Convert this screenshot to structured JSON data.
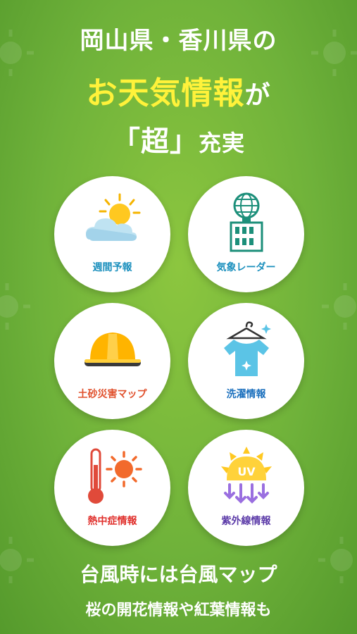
{
  "header": {
    "line1": "岡山県・香川県の",
    "line2_main": "お天気情報",
    "line2_suffix": "が",
    "line3_main": "「超」",
    "line3_suffix": "充実"
  },
  "features": [
    {
      "label": "週間予報",
      "icon": "sun-cloud-icon"
    },
    {
      "label": "気象レーダー",
      "icon": "radar-tower-icon"
    },
    {
      "label": "土砂災害マップ",
      "icon": "hard-hat-icon"
    },
    {
      "label": "洗濯情報",
      "icon": "shirt-hanger-icon"
    },
    {
      "label": "熱中症情報",
      "icon": "thermometer-sun-icon"
    },
    {
      "label": "紫外線情報",
      "icon": "uv-sun-icon"
    }
  ],
  "footer": {
    "line1": "台風時には台風マップ",
    "line2": "桜の開花情報や紅葉情報も"
  },
  "colors": {
    "background": "#6fb23a",
    "highlight": "#fff23a",
    "card": "#ffffff"
  }
}
